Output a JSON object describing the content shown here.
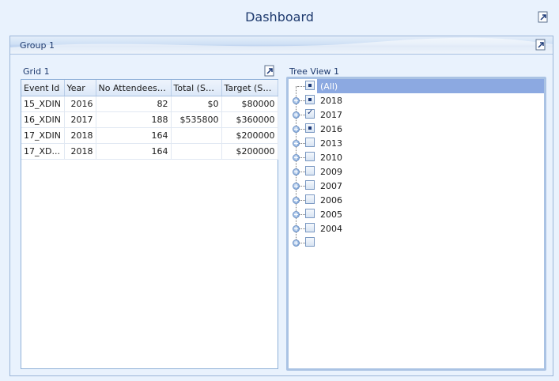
{
  "dashboard": {
    "title": "Dashboard"
  },
  "group": {
    "title": "Group 1"
  },
  "grid": {
    "caption": "Grid 1",
    "columns": [
      "Event Id",
      "Year",
      "No Attendees (...",
      "Total (Sum)",
      "Target (Sum)"
    ],
    "rows": [
      [
        "15_XDIN",
        "2016",
        "82",
        "$0",
        "$80000"
      ],
      [
        "16_XDIN",
        "2017",
        "188",
        "$535800",
        "$360000"
      ],
      [
        "17_XDIN",
        "2018",
        "164",
        "",
        "$200000"
      ],
      [
        "17_XD...",
        "2018",
        "164",
        "",
        "$200000"
      ]
    ]
  },
  "tree": {
    "caption": "Tree View 1",
    "items": [
      {
        "label": "(All)",
        "state": "indeterminate",
        "expandable": false,
        "selected": true
      },
      {
        "label": "2018",
        "state": "indeterminate",
        "expandable": true,
        "selected": false
      },
      {
        "label": "2017",
        "state": "checked",
        "expandable": true,
        "selected": false
      },
      {
        "label": "2016",
        "state": "indeterminate",
        "expandable": true,
        "selected": false
      },
      {
        "label": "2013",
        "state": "unchecked",
        "expandable": true,
        "selected": false
      },
      {
        "label": "2010",
        "state": "unchecked",
        "expandable": true,
        "selected": false
      },
      {
        "label": "2009",
        "state": "unchecked",
        "expandable": true,
        "selected": false
      },
      {
        "label": "2007",
        "state": "unchecked",
        "expandable": true,
        "selected": false
      },
      {
        "label": "2006",
        "state": "unchecked",
        "expandable": true,
        "selected": false
      },
      {
        "label": "2005",
        "state": "unchecked",
        "expandable": true,
        "selected": false
      },
      {
        "label": "2004",
        "state": "unchecked",
        "expandable": true,
        "selected": false
      },
      {
        "label": "",
        "state": "unchecked",
        "expandable": true,
        "selected": false
      }
    ]
  },
  "icons": {
    "dashboard_export": "export-icon",
    "group_export": "export-icon",
    "grid_export": "export-icon"
  },
  "colors": {
    "background": "#e9f2fd",
    "title_text": "#1e3a6e",
    "selection": "#8ca9e1",
    "border": "#8fb0d8"
  }
}
